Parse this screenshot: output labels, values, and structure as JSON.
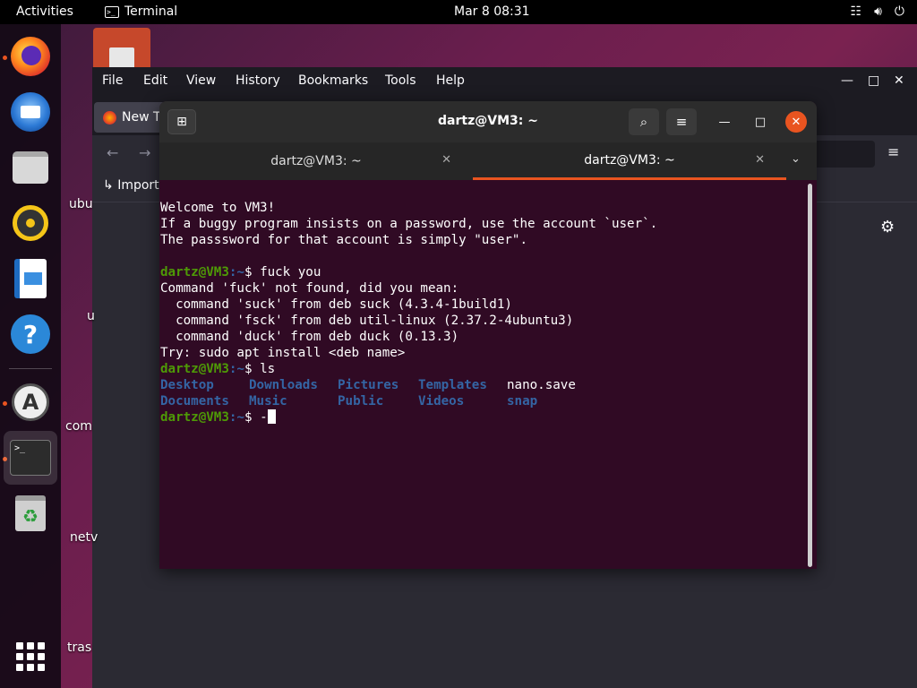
{
  "topbar": {
    "activities": "Activities",
    "app_name": "Terminal",
    "clock": "Mar 8  08:31",
    "tray": [
      "network-icon",
      "volume-icon",
      "power-icon"
    ]
  },
  "dock": {
    "items": [
      "firefox",
      "thunderbird",
      "files",
      "rhythmbox",
      "libreoffice-writer",
      "help",
      "software",
      "terminal",
      "trash"
    ]
  },
  "desktop": {
    "labels": [
      "ubu",
      "u",
      "com",
      "netv",
      "tras"
    ]
  },
  "firefox": {
    "menu": [
      "File",
      "Edit",
      "View",
      "History",
      "Bookmarks",
      "Tools",
      "Help"
    ],
    "tab_label": "New Ta",
    "bookmark": "Import"
  },
  "terminal": {
    "title": "dartz@VM3: ~",
    "tabs": [
      {
        "label": "dartz@VM3: ~",
        "active": false
      },
      {
        "label": "dartz@VM3: ~",
        "active": true
      }
    ],
    "prompt_user": "dartz@VM3",
    "prompt_path": ":~",
    "prompt_symbol": "$ ",
    "lines": {
      "l1": "Welcome to VM3!",
      "l2": "If a buggy program insists on a password, use the account `user`.",
      "l3": "The passsword for that account is simply \"user\".",
      "cmd1": "fuck you",
      "l5": "Command 'fuck' not found, did you mean:",
      "l6": "  command 'suck' from deb suck (4.3.4-1build1)",
      "l7": "  command 'fsck' from deb util-linux (2.37.2-4ubuntu3)",
      "l8": "  command 'duck' from deb duck (0.13.3)",
      "l9": "Try: sudo apt install <deb name>",
      "cmd2": "ls",
      "cmd3": "-"
    },
    "ls_row1": [
      "Desktop",
      "Downloads",
      "Pictures",
      "Templates",
      "nano.save"
    ],
    "ls_row2": [
      "Documents",
      "Music",
      "Public",
      "Videos",
      "snap"
    ],
    "colors": {
      "background": "#300a24",
      "prompt_user": "#4e9a06",
      "prompt_path": "#3465a4",
      "accent": "#e95420"
    }
  }
}
